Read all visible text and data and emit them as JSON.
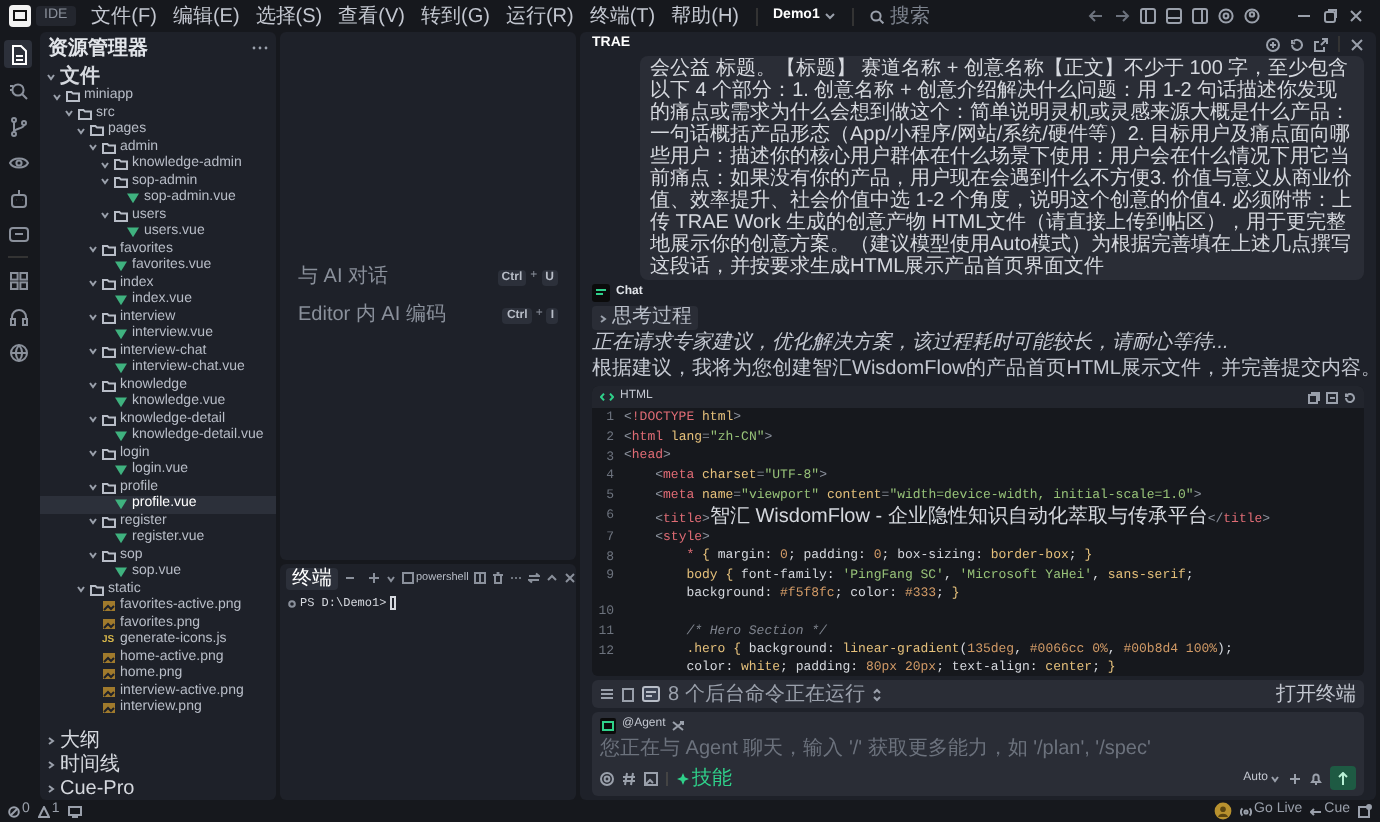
{
  "menu_bar": {
    "app": "IDE",
    "items": [
      "文件(F)",
      "编辑(E)",
      "选择(S)",
      "查看(V)",
      "转到(G)",
      "运行(R)",
      "终端(T)",
      "帮助(H)"
    ],
    "project": "Demo1",
    "search": {
      "placeholder": "搜索"
    }
  },
  "activity_bar": [
    {
      "kind": "files",
      "selected": true
    },
    {
      "kind": "search",
      "selected": false
    },
    {
      "kind": "branch",
      "selected": false
    },
    {
      "kind": "eye",
      "selected": false
    },
    {
      "kind": "robot",
      "selected": false
    },
    {
      "kind": "chat",
      "selected": false
    },
    {
      "kind": "grid",
      "selected": false
    },
    {
      "kind": "headset",
      "selected": false
    },
    {
      "kind": "globe",
      "selected": false
    }
  ],
  "sidebar": {
    "title": "资源管理器",
    "sections": [
      {
        "label": "文件",
        "expanded": true,
        "tree": [
          {
            "label": "miniapp",
            "kind": "folder",
            "expanded": true,
            "children": [
              {
                "label": "src",
                "kind": "folder",
                "expanded": true,
                "children": [
                  {
                    "label": "pages",
                    "kind": "folder",
                    "expanded": true,
                    "children": [
                      {
                        "label": "admin",
                        "kind": "folder",
                        "expanded": true,
                        "children": [
                          {
                            "label": "knowledge-admin",
                            "kind": "folder",
                            "expanded": true
                          },
                          {
                            "label": "sop-admin",
                            "kind": "folder",
                            "expanded": true,
                            "children": [
                              {
                                "label": "sop-admin.vue",
                                "kind": "vue",
                                "selected": false
                              }
                            ]
                          },
                          {
                            "label": "users",
                            "kind": "folder",
                            "expanded": true,
                            "children": [
                              {
                                "label": "users.vue",
                                "kind": "vue",
                                "selected": false
                              }
                            ]
                          }
                        ]
                      },
                      {
                        "label": "favorites",
                        "kind": "folder",
                        "expanded": true,
                        "children": [
                          {
                            "label": "favorites.vue",
                            "kind": "vue",
                            "selected": false
                          }
                        ]
                      },
                      {
                        "label": "index",
                        "kind": "folder",
                        "expanded": true,
                        "children": [
                          {
                            "label": "index.vue",
                            "kind": "vue",
                            "selected": false
                          }
                        ]
                      },
                      {
                        "label": "interview",
                        "kind": "folder",
                        "expanded": true,
                        "children": [
                          {
                            "label": "interview.vue",
                            "kind": "vue",
                            "selected": false
                          }
                        ]
                      },
                      {
                        "label": "interview-chat",
                        "kind": "folder",
                        "expanded": true,
                        "children": [
                          {
                            "label": "interview-chat.vue",
                            "kind": "vue",
                            "selected": false
                          }
                        ]
                      },
                      {
                        "label": "knowledge",
                        "kind": "folder",
                        "expanded": true,
                        "children": [
                          {
                            "label": "knowledge.vue",
                            "kind": "vue",
                            "selected": false
                          }
                        ]
                      },
                      {
                        "label": "knowledge-detail",
                        "kind": "folder",
                        "expanded": true,
                        "children": [
                          {
                            "label": "knowledge-detail.vue",
                            "kind": "vue",
                            "selected": false
                          }
                        ]
                      },
                      {
                        "label": "login",
                        "kind": "folder",
                        "expanded": true,
                        "children": [
                          {
                            "label": "login.vue",
                            "kind": "vue",
                            "selected": false
                          }
                        ]
                      },
                      {
                        "label": "profile",
                        "kind": "folder",
                        "expanded": true,
                        "children": [
                          {
                            "label": "profile.vue",
                            "kind": "vue",
                            "selected": true
                          }
                        ]
                      },
                      {
                        "label": "register",
                        "kind": "folder",
                        "expanded": true,
                        "children": [
                          {
                            "label": "register.vue",
                            "kind": "vue",
                            "selected": false
                          }
                        ]
                      },
                      {
                        "label": "sop",
                        "kind": "folder",
                        "expanded": true,
                        "children": [
                          {
                            "label": "sop.vue",
                            "kind": "vue",
                            "selected": false
                          }
                        ]
                      }
                    ]
                  },
                  {
                    "label": "static",
                    "kind": "folder",
                    "expanded": true,
                    "children": [
                      {
                        "label": "favorites-active.png",
                        "kind": "image",
                        "selected": false
                      },
                      {
                        "label": "favorites.png",
                        "kind": "image",
                        "selected": false
                      },
                      {
                        "label": "generate-icons.js",
                        "kind": "js",
                        "badge": "JS",
                        "selected": false
                      },
                      {
                        "label": "home-active.png",
                        "kind": "image",
                        "selected": false
                      },
                      {
                        "label": "home.png",
                        "kind": "image",
                        "selected": false
                      },
                      {
                        "label": "interview-active.png",
                        "kind": "image",
                        "selected": false
                      },
                      {
                        "label": "interview.png",
                        "kind": "image",
                        "selected": false
                      }
                    ]
                  }
                ]
              }
            ]
          }
        ]
      },
      {
        "label": "大纲",
        "expanded": false
      },
      {
        "label": "时间线",
        "expanded": false
      },
      {
        "label": "Cue-Pro",
        "expanded": false
      }
    ]
  },
  "editor": {
    "hints": [
      {
        "label": "与 AI 对话",
        "keys": [
          {
            "kind": "key",
            "text": "Ctrl"
          },
          {
            "kind": "plus",
            "text": "+"
          },
          {
            "kind": "key",
            "text": "U"
          }
        ]
      },
      {
        "label": "Editor 内 AI 编码",
        "keys": [
          {
            "kind": "key",
            "text": "Ctrl"
          },
          {
            "kind": "plus",
            "text": "+"
          },
          {
            "kind": "key",
            "text": "I"
          }
        ]
      }
    ]
  },
  "terminal": {
    "tabs": [
      {
        "label": "终端",
        "selected": true
      }
    ],
    "shell": "powershell",
    "prompt": "PS D:\\Demo1>"
  },
  "chat": {
    "title": "TRAE",
    "message": "会公益 标题。【标题】 赛道名称 + 创意名称【正文】不少于 100 字，至少包含以下 4 个部分：1. 创意名称 + 创意介绍解决什么问题：用 1-2 句话描述你发现的痛点或需求为什么会想到做这个：简单说明灵机或灵感来源大概是什么产品：一句话概括产品形态（App/小程序/网站/系统/硬件等）2. 目标用户及痛点面向哪些用户：描述你的核心用户群体在什么场景下使用：用户会在什么情况下用它当前痛点：如果没有你的产品，用户现在会遇到什么不方便3. 价值与意义从商业价值、效率提升、社会价值中选 1-2 个角度，说明这个创意的价值4. 必须附带：上传 TRAE Work 生成的创意产物 HTML文件（请直接上传到帖区），用于更完整地展示你的创意方案。（建议模型使用Auto模式）为根据完善填在上述几点撰写这段话，并按要求生成HTML展示产品首页界面文件",
    "sender": "Chat",
    "thinking": {
      "label": "思考过程",
      "expanded": false
    },
    "status": "正在请求专家建议，优化解决方案，该过程耗时可能较长，请耐心等待...",
    "reply": "根据建议，我将为您创建智汇WisdomFlow的产品首页HTML展示文件，并完善提交内容。",
    "code": {
      "language": "HTML",
      "lines": [
        {
          "number": "1",
          "tokens": [
            {
              "kind": "punct",
              "text": "<"
            },
            {
              "kind": "tag",
              "text": "!DOCTYPE"
            },
            {
              "kind": "attr",
              "text": " html"
            },
            {
              "kind": "punct",
              "text": ">"
            }
          ]
        },
        {
          "number": "2",
          "tokens": [
            {
              "kind": "punct",
              "text": "<"
            },
            {
              "kind": "tag",
              "text": "html"
            },
            {
              "kind": "attr",
              "text": " lang"
            },
            {
              "kind": "punct",
              "text": "="
            },
            {
              "kind": "string",
              "text": "\"zh-CN\""
            },
            {
              "kind": "punct",
              "text": ">"
            }
          ]
        },
        {
          "number": "3",
          "tokens": [
            {
              "kind": "punct",
              "text": "<"
            },
            {
              "kind": "tag",
              "text": "head"
            },
            {
              "kind": "punct",
              "text": ">"
            }
          ]
        },
        {
          "number": "4",
          "tokens": [
            {
              "kind": "punct",
              "text": "    <"
            },
            {
              "kind": "tag",
              "text": "meta"
            },
            {
              "kind": "attr",
              "text": " charset"
            },
            {
              "kind": "punct",
              "text": "="
            },
            {
              "kind": "string",
              "text": "\"UTF-8\""
            },
            {
              "kind": "punct",
              "text": ">"
            }
          ]
        },
        {
          "number": "5",
          "tokens": [
            {
              "kind": "punct",
              "text": "    <"
            },
            {
              "kind": "tag",
              "text": "meta"
            },
            {
              "kind": "attr",
              "text": " name"
            },
            {
              "kind": "punct",
              "text": "="
            },
            {
              "kind": "string",
              "text": "\"viewport\""
            },
            {
              "kind": "attr",
              "text": " content"
            },
            {
              "kind": "punct",
              "text": "="
            },
            {
              "kind": "string",
              "text": "\"width=device-width, initial-scale=1.0\""
            },
            {
              "kind": "punct",
              "text": ">"
            }
          ]
        },
        {
          "number": "6",
          "tokens": [
            {
              "kind": "punct",
              "text": "    <"
            },
            {
              "kind": "tag",
              "text": "title"
            },
            {
              "kind": "punct",
              "text": ">"
            },
            {
              "kind": "text",
              "text": "智汇 WisdomFlow - 企业隐性知识自动化萃取与传承平台"
            },
            {
              "kind": "punct",
              "text": "</"
            },
            {
              "kind": "tag",
              "text": "title"
            },
            {
              "kind": "punct",
              "text": ">"
            }
          ]
        },
        {
          "number": "7",
          "tokens": [
            {
              "kind": "punct",
              "text": "    <"
            },
            {
              "kind": "tag",
              "text": "style"
            },
            {
              "kind": "punct",
              "text": ">"
            }
          ]
        },
        {
          "number": "8",
          "tokens": [
            {
              "kind": "tag",
              "text": "        *"
            },
            {
              "kind": "brace",
              "text": " {"
            },
            {
              "kind": "plain",
              "text": " margin: "
            },
            {
              "kind": "number",
              "text": "0"
            },
            {
              "kind": "plain",
              "text": "; padding: "
            },
            {
              "kind": "number",
              "text": "0"
            },
            {
              "kind": "plain",
              "text": "; box-sizing: "
            },
            {
              "kind": "value",
              "text": "border-box"
            },
            {
              "kind": "plain",
              "text": "; "
            },
            {
              "kind": "brace",
              "text": "}"
            }
          ]
        },
        {
          "number": "9",
          "tokens": [
            {
              "kind": "value",
              "text": "        body"
            },
            {
              "kind": "brace",
              "text": " {"
            },
            {
              "kind": "plain",
              "text": " font-family: "
            },
            {
              "kind": "string",
              "text": "'PingFang SC'"
            },
            {
              "kind": "plain",
              "text": ", "
            },
            {
              "kind": "string",
              "text": "'Microsoft YaHei'"
            },
            {
              "kind": "plain",
              "text": ", "
            },
            {
              "kind": "value",
              "text": "sans-serif"
            },
            {
              "kind": "plain",
              "text": ";"
            }
          ]
        },
        {
          "tokens": [
            {
              "kind": "plain",
              "text": "        background: "
            },
            {
              "kind": "number",
              "text": "#f5f8fc"
            },
            {
              "kind": "plain",
              "text": "; color: "
            },
            {
              "kind": "number",
              "text": "#333"
            },
            {
              "kind": "plain",
              "text": ";"
            },
            {
              "kind": "brace",
              "text": " }"
            }
          ]
        },
        {
          "number": "10"
        },
        {
          "number": "11",
          "tokens": [
            {
              "kind": "comment",
              "text": "        /* Hero Section */"
            }
          ]
        },
        {
          "number": "12",
          "tokens": [
            {
              "kind": "value",
              "text": "        .hero"
            },
            {
              "kind": "brace",
              "text": " {"
            },
            {
              "kind": "plain",
              "text": " background: "
            },
            {
              "kind": "value",
              "text": "linear-gradient"
            },
            {
              "kind": "plain",
              "text": "("
            },
            {
              "kind": "number",
              "text": "135deg"
            },
            {
              "kind": "plain",
              "text": ", "
            },
            {
              "kind": "number",
              "text": "#0066cc"
            },
            {
              "kind": "number",
              "text": " 0%"
            },
            {
              "kind": "plain",
              "text": ", "
            },
            {
              "kind": "number",
              "text": "#00b8d4"
            },
            {
              "kind": "number",
              "text": " 100%"
            },
            {
              "kind": "plain",
              "text": ");"
            }
          ]
        },
        {
          "tokens": [
            {
              "kind": "plain",
              "text": "        color: "
            },
            {
              "kind": "value",
              "text": "white"
            },
            {
              "kind": "plain",
              "text": "; padding: "
            },
            {
              "kind": "number",
              "text": "80px 20px"
            },
            {
              "kind": "plain",
              "text": "; text-align: "
            },
            {
              "kind": "value",
              "text": "center"
            },
            {
              "kind": "plain",
              "text": ";"
            },
            {
              "kind": "brace",
              "text": " }"
            }
          ]
        }
      ]
    },
    "background_tasks": "8 个后台命令正在运行",
    "open_terminal": "打开终端",
    "input": {
      "agent": "@Agent",
      "placeholder": "您正在与 Agent 聊天，输入 '/' 获取更多能力，如 '/plan', '/spec'",
      "skill": "技能",
      "mode": "Auto"
    }
  },
  "status_bar": {
    "errors": "0",
    "warnings": "1",
    "go_live": "Go Live",
    "cue": "Cue"
  }
}
